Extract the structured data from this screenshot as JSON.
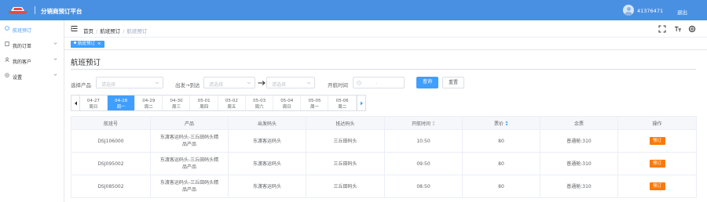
{
  "app": {
    "title": "分销商预订平台",
    "user_id": "41376471",
    "logout_label": "退出"
  },
  "sidebar": {
    "items": [
      {
        "label": "航班预订",
        "icon": "ship-icon"
      },
      {
        "label": "我的订单",
        "icon": "order-icon"
      },
      {
        "label": "我的客户",
        "icon": "customer-icon"
      },
      {
        "label": "设置",
        "icon": "gear-icon"
      }
    ]
  },
  "breadcrumb": {
    "items": [
      "首页",
      "航班预订",
      "航班预订"
    ]
  },
  "tags": {
    "active": "航班预订"
  },
  "page": {
    "title": "航班预订"
  },
  "filters": {
    "product_label": "选择产品",
    "route_label": "出发→到达",
    "time_label": "开航时间",
    "placeholder": "请选择",
    "time_placeholder": "-",
    "search_label": "查询",
    "reset_label": "重置"
  },
  "dates": [
    {
      "date": "04-27",
      "day": "周日"
    },
    {
      "date": "04-28",
      "day": "周一"
    },
    {
      "date": "04-29",
      "day": "周二"
    },
    {
      "date": "04-30",
      "day": "周三"
    },
    {
      "date": "05-01",
      "day": "周四"
    },
    {
      "date": "05-02",
      "day": "周五"
    },
    {
      "date": "05-03",
      "day": "周六"
    },
    {
      "date": "05-04",
      "day": "周日"
    },
    {
      "date": "05-05",
      "day": "周一"
    },
    {
      "date": "05-06",
      "day": "周二"
    }
  ],
  "table": {
    "headers": [
      "航班号",
      "产品",
      "出发码头",
      "抵达码头",
      "开航时间",
      "票价",
      "余票",
      "操作"
    ],
    "rows": [
      {
        "flight": "DSJ106000",
        "product_1": "东渡客运码头-三丘田码头精",
        "product_2": "品产品",
        "from": "东渡客运码头",
        "to": "三丘田码头",
        "time": "10:50",
        "price": "80",
        "seats": "普通舱:310",
        "action": "预订"
      },
      {
        "flight": "DSJ095002",
        "product_1": "东渡客运码头-三丘田码头精",
        "product_2": "品产品",
        "from": "东渡客运码头",
        "to": "三丘田码头",
        "time": "09:50",
        "price": "80",
        "seats": "普通舱:310",
        "action": "预订"
      },
      {
        "flight": "DSJ085002",
        "product_1": "东渡客运码头-三丘田码头精",
        "product_2": "品产品",
        "from": "东渡客运码头",
        "to": "三丘田码头",
        "time": "08:50",
        "price": "80",
        "seats": "普通舱:310",
        "action": "预订"
      }
    ]
  },
  "colors": {
    "primary": "#409eff",
    "header": "#4a90e2",
    "book": "#fa7a0a"
  }
}
